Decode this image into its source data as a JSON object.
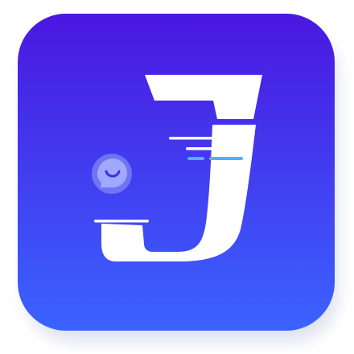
{
  "app_icon": {
    "logo_letter": "J",
    "colors": {
      "gradient_top": "#4A17E0",
      "gradient_bottom": "#3A63FF",
      "glyph": "#FFFFFF",
      "speed_line_accent": "#4FB0FF",
      "chat_badge_outer": "#6F74F2",
      "chat_badge_inner": "#9EA9FF",
      "chat_badge_smile": "#4A2BE0"
    },
    "icons": [
      "letter-j-glyph",
      "chat-bubble-smile-icon",
      "speed-lines"
    ]
  }
}
